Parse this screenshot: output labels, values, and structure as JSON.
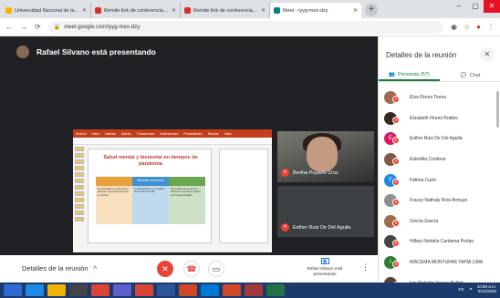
{
  "browser": {
    "tabs": [
      {
        "title": "Universidad Nacional de la Amaz",
        "color": "#f4b400"
      },
      {
        "title": "Remite link de conferencia virtual",
        "color": "#d93025"
      },
      {
        "title": "Remite link de conferencia virtual",
        "color": "#d93025"
      },
      {
        "title": "Meet - iyyg-mxo-dzy",
        "color": "#00897b"
      }
    ],
    "url": "meet.google.com/iyyg-mxo-dzy"
  },
  "meet": {
    "presenter_text": "Rafael Silvano está presentando",
    "slide": {
      "title": "Salud mental y bienestar en tiempos de pandemia",
      "columns": [
        {
          "header": "",
          "color": "#e9a23b",
          "body": "La ansiedad y la depresión afectan a personas de todo el mundo"
        },
        {
          "header": "Bienestar emocional",
          "color": "#3f8fd2",
          "body": "La prevención y el cuidado de la salud mental"
        },
        {
          "header": "",
          "color": "#6aa84f",
          "body": "El cuidado personal y la atención a la salud mental son fundamentales"
        }
      ]
    },
    "tiles": [
      {
        "name": "Bertha Puyarte Cruz"
      },
      {
        "name": "Esther Ruiz De Del Aguila"
      }
    ],
    "bottom": {
      "details_label": "Detalles de la reunión",
      "presenting_label": "Rafael Silvano está presentando"
    }
  },
  "panel": {
    "title": "Detalles de la reunión",
    "tab_people": "Personas (57)",
    "tab_chat": "Chat",
    "participants": [
      {
        "name": "Elsa Flores Torres",
        "color": "#9e6b4a",
        "initial": ""
      },
      {
        "name": "Elizabeth Flores Robles",
        "color": "#3a2a20",
        "initial": ""
      },
      {
        "name": "Esther Ruiz De Del Aguila",
        "color": "#d81b60",
        "initial": "E"
      },
      {
        "name": "Estrellita Cordova",
        "color": "#7e5a44",
        "initial": ""
      },
      {
        "name": "Fátima Curto",
        "color": "#1e88e5",
        "initial": "F"
      },
      {
        "name": "Fracsy Nathaly Ríos Armuyo",
        "color": "#8f8f8f",
        "initial": ""
      },
      {
        "name": "Grecia García",
        "color": "#9c6d4b",
        "initial": ""
      },
      {
        "name": "Hillary Nohelia Cardama Portao",
        "color": "#444444",
        "initial": ""
      },
      {
        "name": "IRACEMA MONTUFAR TAPIA LIMA",
        "color": "#2e7d32",
        "initial": "I"
      },
      {
        "name": "Isis Mabelle Vargas Bellido",
        "color": "#5d4037",
        "initial": ""
      }
    ]
  },
  "taskbar": {
    "apps": [
      {
        "icon": "windows",
        "color": "#2d6bd1"
      },
      {
        "icon": "ie",
        "color": "#1e88e5"
      },
      {
        "icon": "explorer",
        "color": "#f0b400"
      },
      {
        "icon": "media",
        "color": "#444"
      },
      {
        "icon": "chrome",
        "color": "#db4437"
      },
      {
        "icon": "teams",
        "color": "#5b5fc7"
      },
      {
        "icon": "chrome2",
        "color": "#db4437"
      },
      {
        "icon": "word",
        "color": "#2b579a"
      },
      {
        "icon": "ppt",
        "color": "#d24726"
      },
      {
        "icon": "outlook",
        "color": "#0078d4"
      },
      {
        "icon": "ppt2",
        "color": "#d24726"
      },
      {
        "icon": "access",
        "color": "#a4373a"
      },
      {
        "icon": "excel",
        "color": "#217346"
      }
    ],
    "lang": "ES",
    "time": "10:59 a.m.",
    "date": "8/10/2020"
  }
}
